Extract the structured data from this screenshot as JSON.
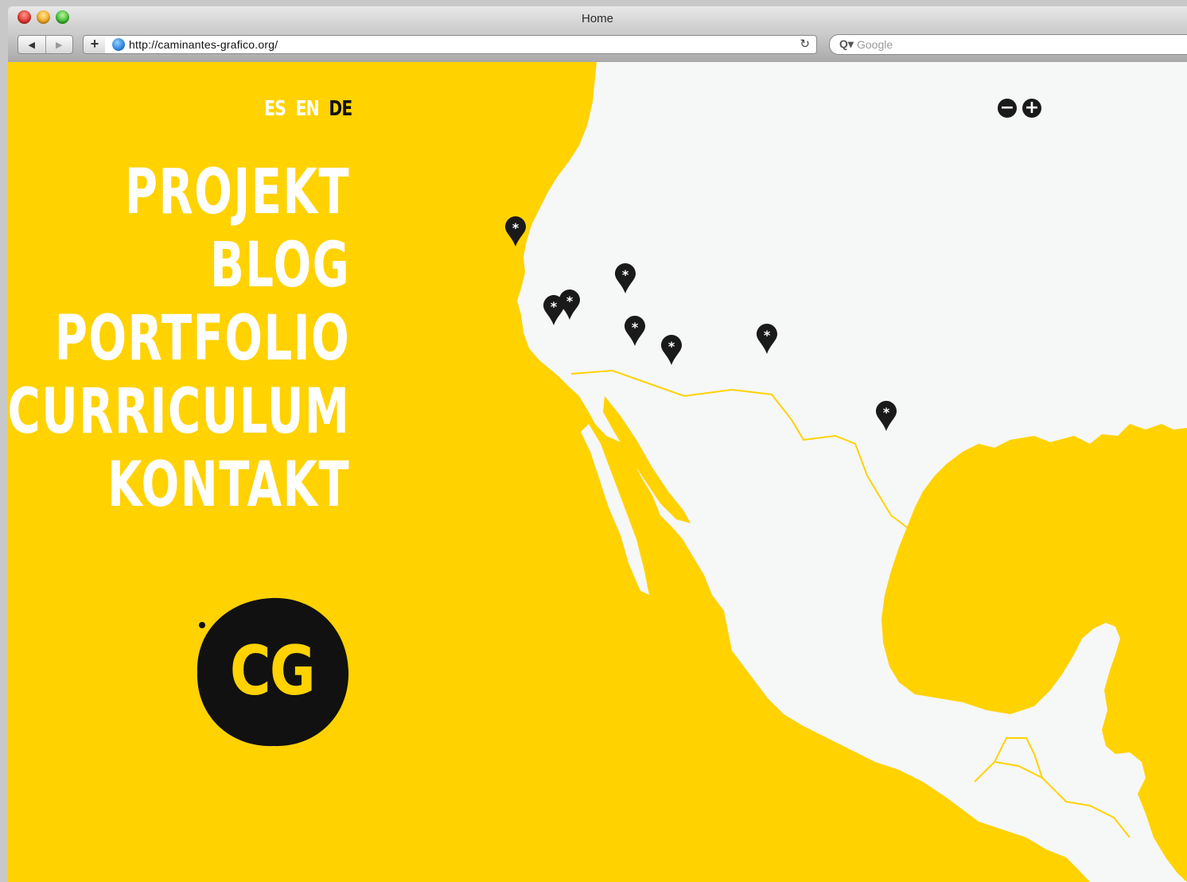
{
  "browser": {
    "window_title": "Home",
    "url": "http://caminantes-grafico.org/",
    "search_placeholder": "Google",
    "back_label": "◀",
    "forward_label": "▶",
    "add_label": "+",
    "reload_label": "↻",
    "search_prefix": "Q▾"
  },
  "site": {
    "languages": [
      {
        "label": "ES",
        "active": false
      },
      {
        "label": "EN",
        "active": false
      },
      {
        "label": "DE",
        "active": true
      }
    ],
    "menu": [
      "PROJEKT",
      "BLOG",
      "PORTFOLIO",
      "CURRICULUM",
      "KONTAKT"
    ],
    "logo_text": "CG",
    "zoom_out_label": "−",
    "zoom_in_label": "+",
    "colors": {
      "background": "#ffd200",
      "land": "#f6f7f7",
      "marker": "#1a1a1a",
      "menu_text": "#ffffff",
      "active_lang": "#111111"
    }
  }
}
